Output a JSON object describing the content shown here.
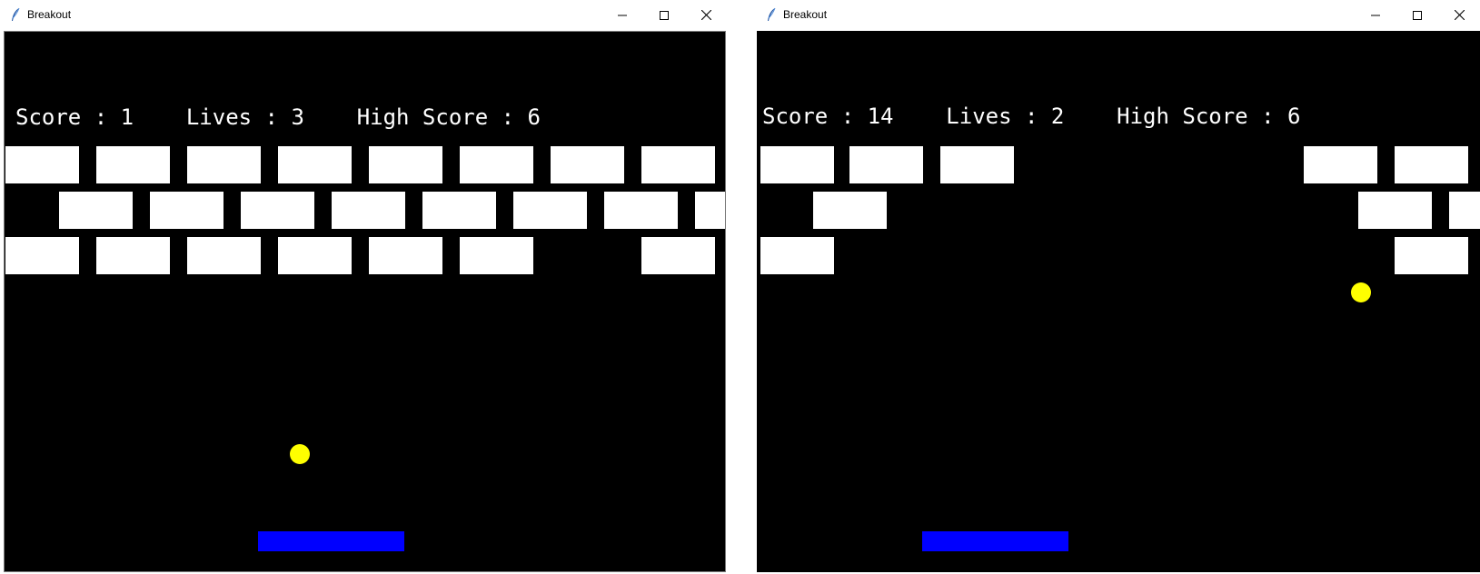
{
  "colors": {
    "canvas_bg": "#000000",
    "brick": "#ffffff",
    "ball": "#ffff00",
    "paddle": "#0000ff",
    "hud_text": "#ffffff"
  },
  "windows": [
    {
      "title": "Breakout",
      "controls": {
        "minimize": "minimize-icon",
        "maximize": "maximize-icon",
        "close": "close-icon"
      },
      "hud": {
        "score_label": "Score : 1",
        "lives_label": "Lives : 3",
        "high_score_label": "High Score : 6"
      },
      "bricks_remaining": {
        "row_1": [
          1,
          1,
          1,
          1,
          1,
          1,
          1,
          1
        ],
        "row_2": [
          1,
          1,
          1,
          1,
          1,
          1,
          1,
          1
        ],
        "row_3": [
          1,
          1,
          1,
          1,
          1,
          1,
          0,
          1
        ]
      }
    },
    {
      "title": "Breakout",
      "controls": {
        "minimize": "minimize-icon",
        "maximize": "maximize-icon",
        "close": "close-icon"
      },
      "hud": {
        "score_label": "Score : 14",
        "lives_label": "Lives : 2",
        "high_score_label": "High Score : 6"
      },
      "bricks_remaining": {
        "row_1": [
          1,
          1,
          1,
          0,
          0,
          0,
          1,
          1
        ],
        "row_2": [
          1,
          0,
          0,
          0,
          0,
          0,
          0,
          1,
          1
        ],
        "row_3": [
          1,
          0,
          0,
          0,
          0,
          0,
          0,
          1
        ]
      }
    }
  ]
}
